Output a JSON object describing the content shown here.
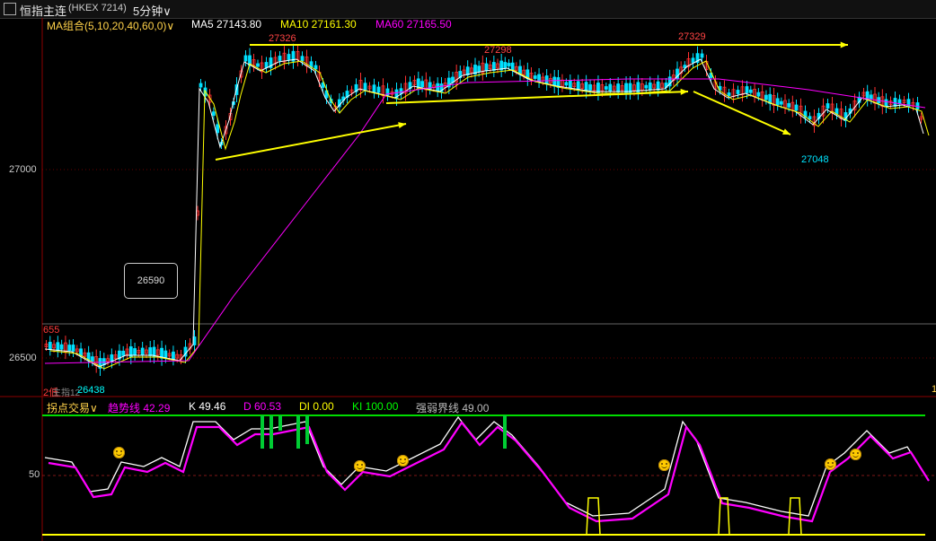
{
  "title_bar": {
    "symbol_icon": "chart-icon",
    "symbol_name": "恒指主连",
    "symbol_code": "(HKEX 7214)",
    "period": "5分钟"
  },
  "ma_panel": {
    "selector_label": "MA组合(5,10,20,40,60,0)",
    "ma5": "MA5 27143.80",
    "ma10": "MA10 27161.30",
    "ma60": "MA60 27165.50",
    "colors": {
      "ma5": "#ffffff",
      "ma10": "#ffff00",
      "ma60": "#ff00ff"
    }
  },
  "price_axis": {
    "labels": [
      "27000",
      "26500"
    ],
    "left_tag": "655",
    "bottom_left_tag": "2低",
    "bottom_left_value": "26438",
    "bottom_left_prefix": "主指12"
  },
  "annotations": {
    "high_1": "27326",
    "high_2": "27298",
    "high_3": "27329",
    "low_1": "27048",
    "callout": "26590"
  },
  "indicator_panel": {
    "selector_label": "拐点交易",
    "trend": "趋势线 42.29",
    "k": "K 49.46",
    "d": "D 60.53",
    "di": "DI 0.00",
    "ki": "KI 100.00",
    "strength": "强弱界线 49.00",
    "axis_50": "50",
    "right_edge": "1",
    "colors": {
      "trend": "#ff00ff",
      "k": "#ffffff",
      "d": "#ff00ff",
      "di": "#ffff00",
      "ki": "#00ff00"
    }
  }
}
